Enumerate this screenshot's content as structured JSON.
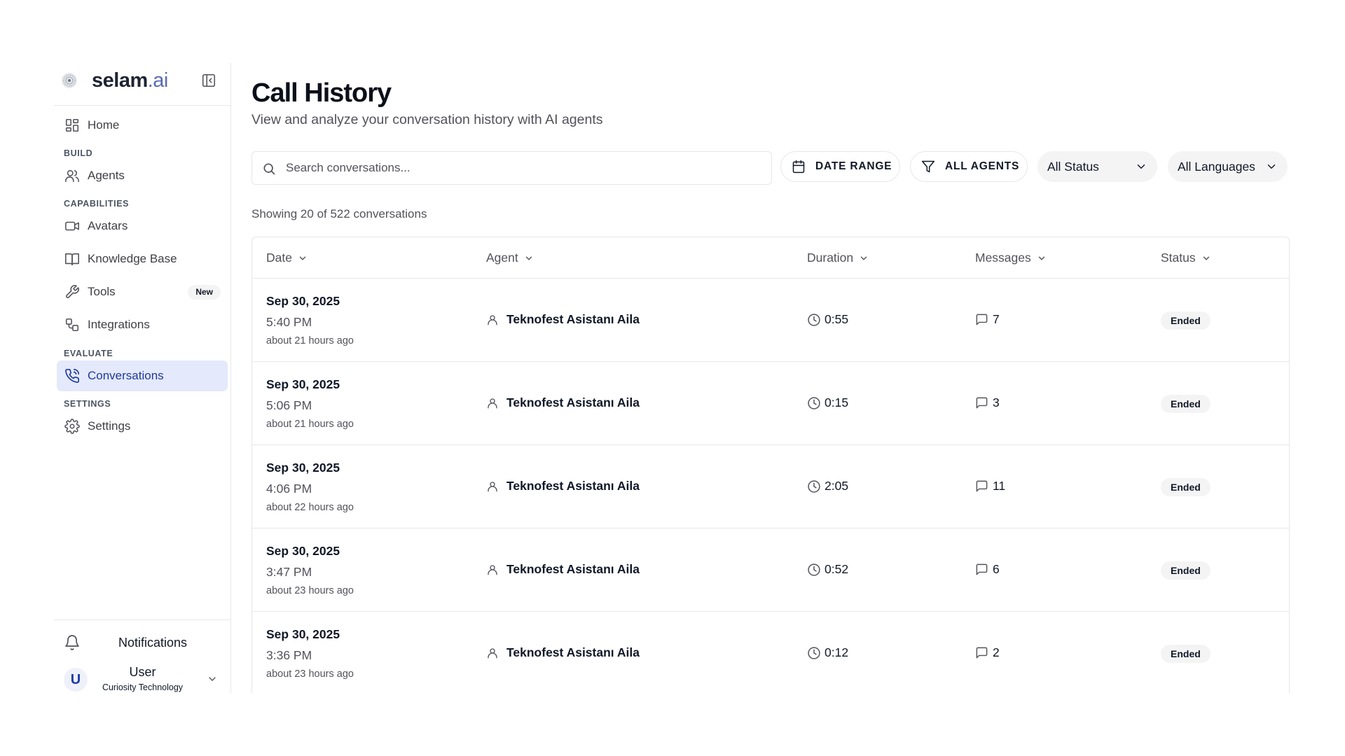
{
  "brand": {
    "name": "selam",
    "suffix": ".ai"
  },
  "sidebar": {
    "home": "Home",
    "section_build": "BUILD",
    "agents": "Agents",
    "section_capabilities": "CAPABILITIES",
    "avatars": "Avatars",
    "knowledge_base": "Knowledge Base",
    "tools": "Tools",
    "tools_badge": "New",
    "integrations": "Integrations",
    "section_evaluate": "EVALUATE",
    "conversations": "Conversations",
    "section_settings": "SETTINGS",
    "settings": "Settings",
    "notifications": "Notifications",
    "user_name": "User",
    "user_org": "Curiosity Technology",
    "user_initial": "U"
  },
  "header": {
    "title": "Call History",
    "subtitle": "View and analyze your conversation history with AI agents"
  },
  "filters": {
    "search_placeholder": "Search conversations...",
    "date_range": "DATE RANGE",
    "all_agents": "ALL AGENTS",
    "status": "All Status",
    "languages": "All Languages"
  },
  "summary": "Showing 20 of 522 conversations",
  "table": {
    "columns": {
      "date": "Date",
      "agent": "Agent",
      "duration": "Duration",
      "messages": "Messages",
      "status": "Status"
    },
    "rows": [
      {
        "date": "Sep 30, 2025",
        "time": "5:40 PM",
        "ago": "about 21 hours ago",
        "agent": "Teknofest Asistanı Aila",
        "duration": "0:55",
        "messages": "7",
        "status": "Ended"
      },
      {
        "date": "Sep 30, 2025",
        "time": "5:06 PM",
        "ago": "about 21 hours ago",
        "agent": "Teknofest Asistanı Aila",
        "duration": "0:15",
        "messages": "3",
        "status": "Ended"
      },
      {
        "date": "Sep 30, 2025",
        "time": "4:06 PM",
        "ago": "about 22 hours ago",
        "agent": "Teknofest Asistanı Aila",
        "duration": "2:05",
        "messages": "11",
        "status": "Ended"
      },
      {
        "date": "Sep 30, 2025",
        "time": "3:47 PM",
        "ago": "about 23 hours ago",
        "agent": "Teknofest Asistanı Aila",
        "duration": "0:52",
        "messages": "6",
        "status": "Ended"
      },
      {
        "date": "Sep 30, 2025",
        "time": "3:36 PM",
        "ago": "about 23 hours ago",
        "agent": "Teknofest Asistanı Aila",
        "duration": "0:12",
        "messages": "2",
        "status": "Ended"
      }
    ]
  },
  "colors": {
    "accent": "#1e3a9a",
    "active_bg": "#e4e9fb",
    "border": "#e5e7eb",
    "muted": "#52525b"
  }
}
